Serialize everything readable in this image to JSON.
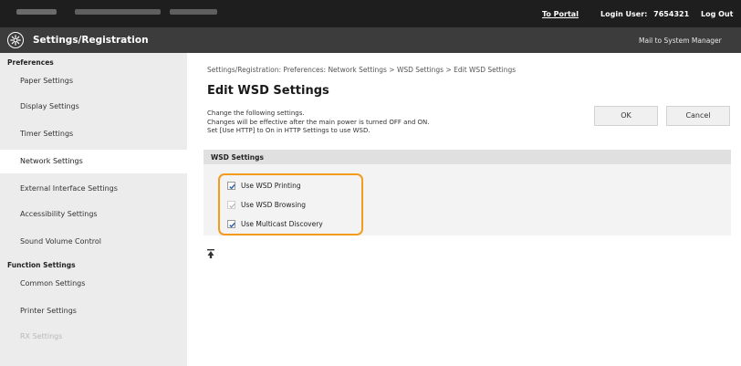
{
  "topbar": {
    "portal_label": "To Portal",
    "login_label": "Login User:",
    "login_user": "7654321",
    "logout_label": "Log Out"
  },
  "header": {
    "logo_icon": "settings-gear-logo-icon",
    "title": "Settings/Registration",
    "mail_link": "Mail to System Manager"
  },
  "sidebar": {
    "sections": [
      {
        "title": "Preferences",
        "items": [
          {
            "label": "Paper Settings"
          },
          {
            "label": "Display Settings"
          },
          {
            "label": "Timer Settings"
          },
          {
            "label": "Network Settings",
            "active": true
          },
          {
            "label": "External Interface Settings"
          },
          {
            "label": "Accessibility Settings"
          },
          {
            "label": "Sound Volume Control"
          }
        ]
      },
      {
        "title": "Function Settings",
        "items": [
          {
            "label": "Common Settings"
          },
          {
            "label": "Printer Settings"
          },
          {
            "label": "RX Settings"
          }
        ]
      }
    ]
  },
  "main": {
    "breadcrumb": "Settings/Registration: Preferences: Network Settings > WSD Settings > Edit WSD Settings",
    "title": "Edit WSD Settings",
    "desc_lines": [
      "Change the following settings.",
      "Changes will be effective after the main power is turned OFF and ON.",
      "Set [Use HTTP] to On in HTTP Settings to use WSD."
    ],
    "ok_label": "OK",
    "cancel_label": "Cancel",
    "section_title": "WSD Settings",
    "options": [
      {
        "label": "Use WSD Printing",
        "checked": true,
        "enabled": true
      },
      {
        "label": "Use WSD Browsing",
        "checked": true,
        "enabled": false
      },
      {
        "label": "Use Multicast Discovery",
        "checked": true,
        "enabled": true
      }
    ],
    "highlight_color": "#f39b1c",
    "top_icon": "scroll-to-top-icon"
  },
  "colors": {
    "topbar": "#1e1e1e",
    "header": "#3c3c3c",
    "sidebar": "#ececec",
    "accent": "#f39b1c"
  }
}
